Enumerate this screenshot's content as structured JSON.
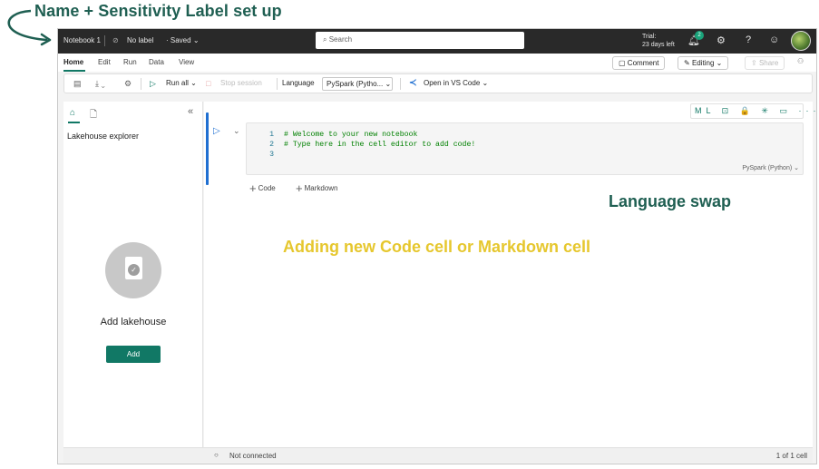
{
  "annotations": {
    "top": "Name + Sensitivity Label set up",
    "language": "Language swap",
    "add_cell": "Adding new Code cell or Markdown cell"
  },
  "topbar": {
    "notebook_name": "Notebook 1",
    "label": "No label",
    "saved": "· Saved",
    "search_placeholder": "Search",
    "trial_line1": "Trial:",
    "trial_line2": "23 days left",
    "notification_count": "2"
  },
  "menubar": {
    "tabs": [
      "Home",
      "Edit",
      "Run",
      "Data",
      "View"
    ],
    "comment": "Comment",
    "editing": "Editing",
    "share": "Share"
  },
  "toolbar": {
    "run_all": "Run all",
    "stop_session": "Stop session",
    "language_label": "Language",
    "language_value": "PySpark (Pytho...",
    "open_vscode": "Open in VS Code"
  },
  "sidebar": {
    "title": "Lakehouse explorer",
    "add_title": "Add lakehouse",
    "add_button": "Add"
  },
  "cell": {
    "lines": [
      {
        "num": "1",
        "code": "# Welcome to your new notebook"
      },
      {
        "num": "2",
        "code": "# Type here in the cell editor to add code!"
      },
      {
        "num": "3",
        "code": ""
      }
    ],
    "language": "PySpark (Python)",
    "tools": "ML ⊡ 🔒 ✳ ▭ ··· 🗑",
    "add_code": "Code",
    "add_markdown": "Markdown"
  },
  "status": {
    "connection": "Not connected",
    "cell_count": "1 of 1 cell"
  },
  "colors": {
    "accent": "#117865",
    "annotation_green": "#1f5f52",
    "annotation_yellow": "#e6c72e",
    "run_blue": "#1f6fd1"
  }
}
